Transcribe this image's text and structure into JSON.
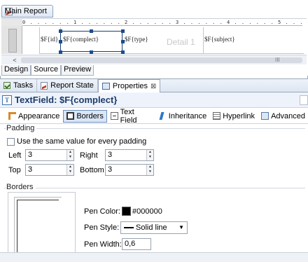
{
  "editor": {
    "tab_label": "Main Report",
    "ruler_text": "0 . . . . . . 1 . . . . . . 2 . . . . . . 3 . . . . . . 4 . . . . . . 5 . . . . . .",
    "fields": [
      "$F{id}",
      "$F{complect}",
      "$F{type}",
      "$F{subject}"
    ],
    "band_watermark": "Detail 1",
    "scroll_left_arrow": "<",
    "scroll_grip": "III",
    "subtabs": [
      "Design",
      "Source",
      "Preview"
    ]
  },
  "view_tabs": [
    {
      "label": "Tasks",
      "icon": "tasks-icon"
    },
    {
      "label": "Report State",
      "icon": "report-state-icon"
    },
    {
      "label": "Properties",
      "icon": "properties-icon",
      "active": true
    }
  ],
  "view_close_glyph": "⊠",
  "properties": {
    "title": "TextField: $F{complect}",
    "title_icon_glyph": "T",
    "section_tabs": [
      {
        "label": "Appearance",
        "icon": "appearance-icon"
      },
      {
        "label": "Borders",
        "icon": "borders-icon",
        "active": true
      },
      {
        "label": "Text Field",
        "icon": "text-field-icon"
      },
      {
        "label": "Inheritance",
        "icon": "inheritance-icon"
      },
      {
        "label": "Hyperlink",
        "icon": "hyperlink-icon"
      },
      {
        "label": "Advanced",
        "icon": "advanced-icon"
      }
    ],
    "padding": {
      "group_label": "Padding",
      "same_value_label": "Use the same value for every padding",
      "same_value_checked": false,
      "left_label": "Left",
      "left_value": "3",
      "right_label": "Right",
      "right_value": "3",
      "top_label": "Top",
      "top_value": "3",
      "bottom_label": "Bottom",
      "bottom_value": "3"
    },
    "borders": {
      "group_label": "Borders",
      "pen_color_label": "Pen Color:",
      "pen_color_value": "#000000",
      "pen_style_label": "Pen Style:",
      "pen_style_value": "Solid line",
      "pen_width_label": "Pen Width:",
      "pen_width_value": "0,6"
    }
  },
  "colors": {
    "accent": "#1c3b6a",
    "selection": "#1a3d73",
    "tab_bg": "#dce6f2"
  }
}
